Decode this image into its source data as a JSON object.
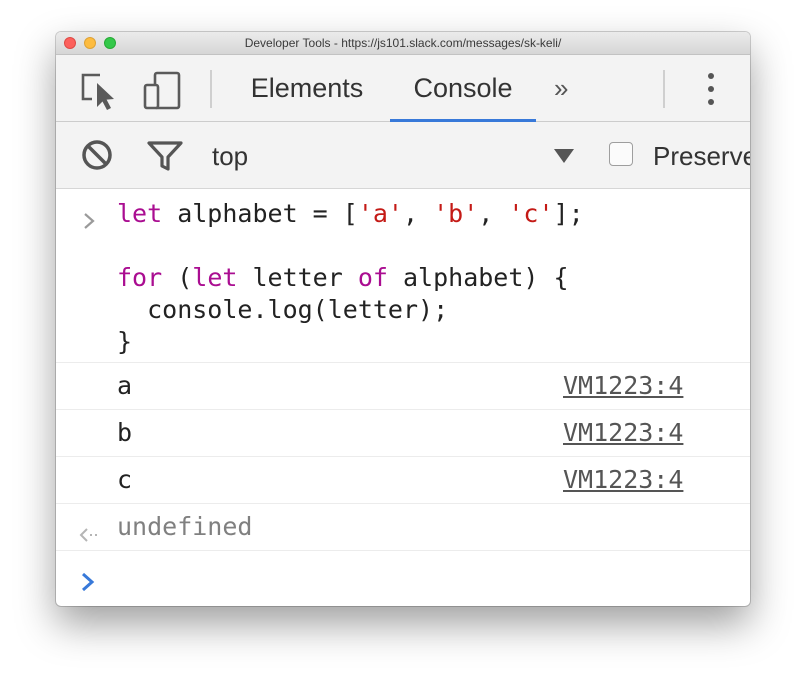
{
  "window": {
    "title": "Developer Tools - https://js101.slack.com/messages/sk-keli/"
  },
  "tabs": {
    "elements_label": "Elements",
    "console_label": "Console",
    "active": "Console",
    "more_label": "»"
  },
  "toolbar": {
    "context_label": "top",
    "preserve_label": "Preserve log"
  },
  "console": {
    "input_code": [
      [
        {
          "t": "kw",
          "v": "let"
        },
        {
          "t": "p",
          "v": " alphabet = ["
        },
        {
          "t": "str",
          "v": "'a'"
        },
        {
          "t": "p",
          "v": ", "
        },
        {
          "t": "str",
          "v": "'b'"
        },
        {
          "t": "p",
          "v": ", "
        },
        {
          "t": "str",
          "v": "'c'"
        },
        {
          "t": "p",
          "v": "];"
        }
      ],
      [],
      [
        {
          "t": "kw",
          "v": "for"
        },
        {
          "t": "p",
          "v": " ("
        },
        {
          "t": "kw",
          "v": "let"
        },
        {
          "t": "p",
          "v": " letter "
        },
        {
          "t": "kw",
          "v": "of"
        },
        {
          "t": "p",
          "v": " alphabet) {"
        }
      ],
      [
        {
          "t": "p",
          "v": "  console.log(letter);"
        }
      ],
      [
        {
          "t": "p",
          "v": "}"
        }
      ]
    ],
    "logs": [
      {
        "text": "a",
        "source": "VM1223:4"
      },
      {
        "text": "b",
        "source": "VM1223:4"
      },
      {
        "text": "c",
        "source": "VM1223:4"
      }
    ],
    "result": "undefined"
  },
  "colors": {
    "keyword": "#aa0d91",
    "string": "#c41a16",
    "accent": "#3879d9",
    "result_text": "#808080"
  },
  "icons": [
    "inspect-element-icon",
    "device-toolbar-icon",
    "more-tabs-icon",
    "kebab-menu-icon",
    "clear-console-icon",
    "filter-icon",
    "dropdown-arrow-icon",
    "input-chevron-icon",
    "result-arrow-icon",
    "prompt-chevron-icon"
  ]
}
